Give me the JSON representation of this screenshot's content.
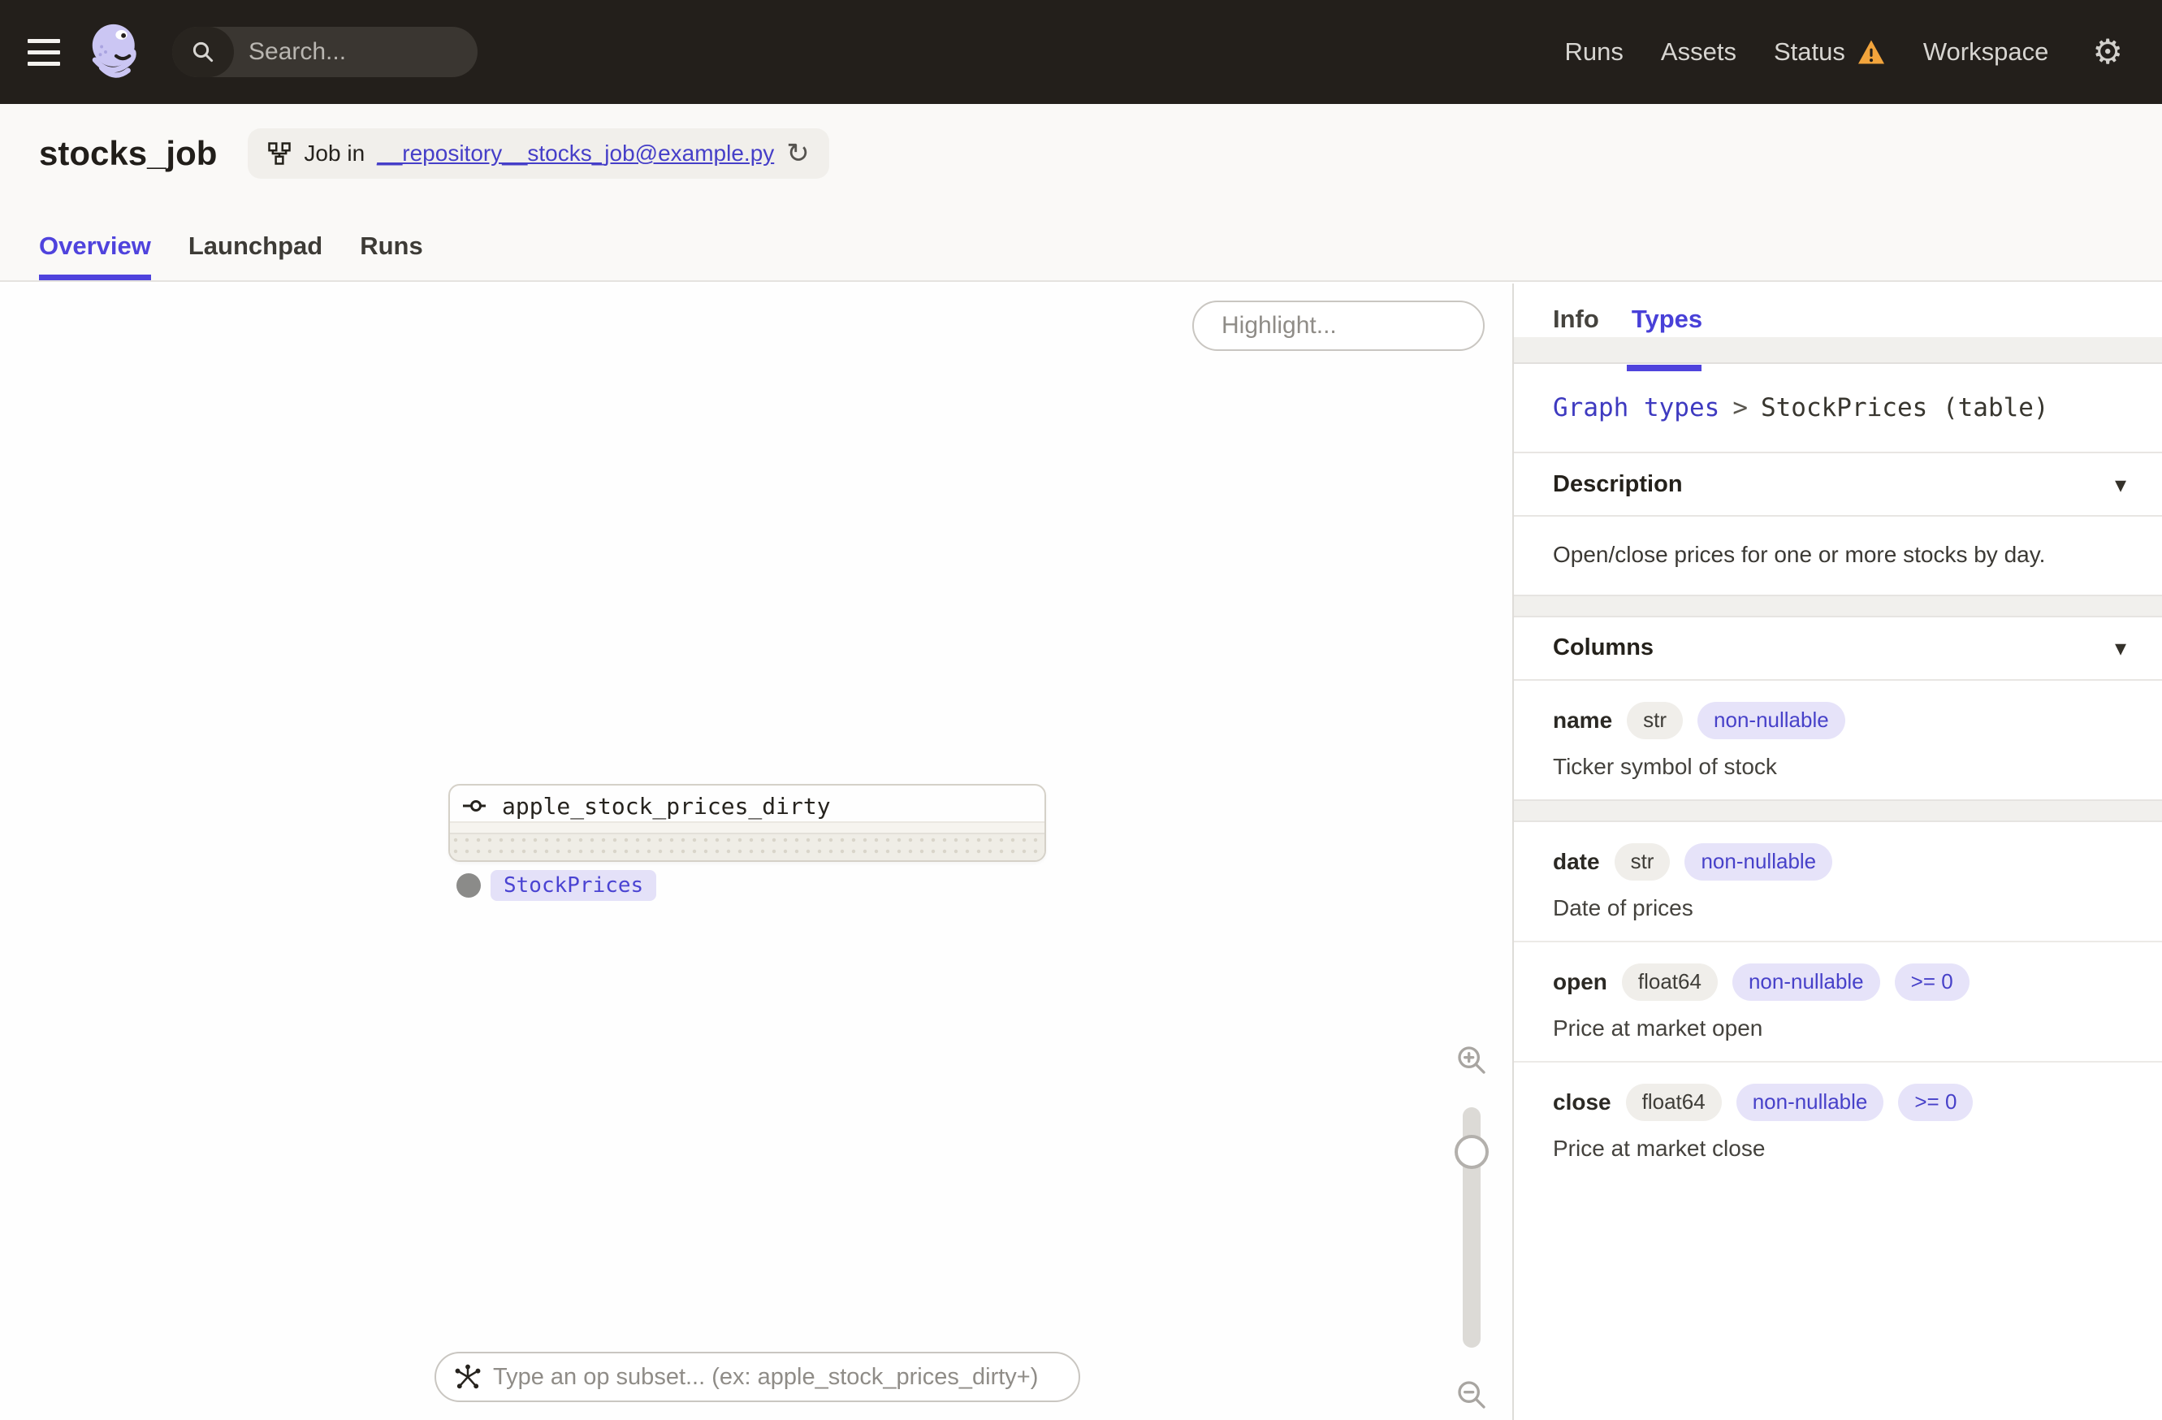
{
  "topbar": {
    "search_placeholder": "Search...",
    "search_shortcut": "/",
    "nav": [
      {
        "label": "Runs"
      },
      {
        "label": "Assets"
      },
      {
        "label": "Status"
      },
      {
        "label": "Workspace"
      }
    ]
  },
  "header": {
    "title": "stocks_job",
    "job_prefix": "Job in",
    "job_link": "__repository__stocks_job@example.py",
    "reload_icon": "refresh-icon"
  },
  "tabs": [
    {
      "label": "Overview",
      "active": true
    },
    {
      "label": "Launchpad",
      "active": false
    },
    {
      "label": "Runs",
      "active": false
    }
  ],
  "canvas": {
    "highlight_placeholder": "Highlight...",
    "node": {
      "name": "apple_stock_prices_dirty",
      "output_type": "StockPrices"
    },
    "op_subset_placeholder": "Type an op subset... (ex: apple_stock_prices_dirty+)"
  },
  "panel": {
    "tabs": [
      {
        "label": "Info",
        "active": false
      },
      {
        "label": "Types",
        "active": true
      }
    ],
    "breadcrumb": {
      "link": "Graph types",
      "separator": ">",
      "current": "StockPrices (table)"
    },
    "description": {
      "title": "Description",
      "body": "Open/close prices for one or more stocks by day."
    },
    "columns": {
      "title": "Columns",
      "items": [
        {
          "name": "name",
          "type": "str",
          "tags": [
            "non-nullable"
          ],
          "description": "Ticker symbol of stock"
        },
        {
          "name": "date",
          "type": "str",
          "tags": [
            "non-nullable"
          ],
          "description": "Date of prices"
        },
        {
          "name": "open",
          "type": "float64",
          "tags": [
            "non-nullable",
            ">= 0"
          ],
          "description": "Price at market open"
        },
        {
          "name": "close",
          "type": "float64",
          "tags": [
            "non-nullable",
            ">= 0"
          ],
          "description": "Price at market close"
        }
      ]
    }
  },
  "colors": {
    "accent": "#4F43DD",
    "warning": "#F2A43C",
    "topbar_bg": "#231F1B",
    "header_bg": "#FAF9F7",
    "constraint_pill_bg": "#E6E3F9",
    "type_pill_bg": "#F0EEEA"
  }
}
